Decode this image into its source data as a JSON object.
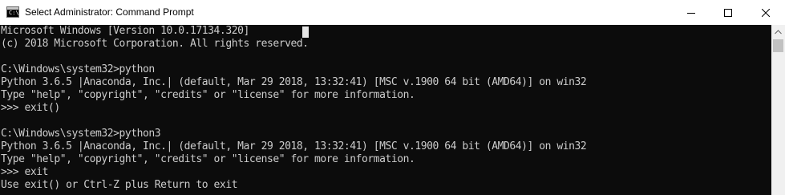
{
  "window": {
    "title": "Select Administrator: Command Prompt",
    "icon": "cmd-icon",
    "icon_glyph": "C:\\",
    "controls": {
      "minimize_icon": "minimize-icon",
      "maximize_icon": "maximize-icon",
      "close_icon": "close-icon"
    }
  },
  "console": {
    "lines": [
      "Microsoft Windows [Version 10.0.17134.320]",
      "(c) 2018 Microsoft Corporation. All rights reserved.",
      "",
      "C:\\Windows\\system32>python",
      "Python 3.6.5 |Anaconda, Inc.| (default, Mar 29 2018, 13:32:41) [MSC v.1900 64 bit (AMD64)] on win32",
      "Type \"help\", \"copyright\", \"credits\" or \"license\" for more information.",
      ">>> exit()",
      "",
      "C:\\Windows\\system32>python3",
      "Python 3.6.5 |Anaconda, Inc.| (default, Mar 29 2018, 13:32:41) [MSC v.1900 64 bit (AMD64)] on win32",
      "Type \"help\", \"copyright\", \"credits\" or \"license\" for more information.",
      ">>> exit",
      "Use exit() or Ctrl-Z plus Return to exit"
    ]
  },
  "colors": {
    "console_background": "#0c0c0c",
    "console_text": "#cccccc",
    "titlebar_background": "#ffffff"
  }
}
